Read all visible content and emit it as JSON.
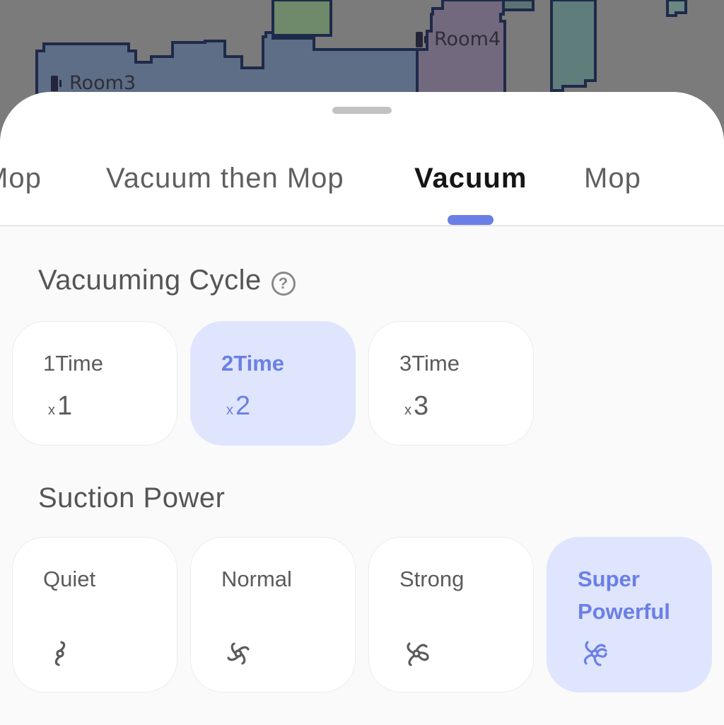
{
  "map": {
    "rooms": [
      {
        "label": "Room3"
      },
      {
        "label": "Room4"
      }
    ]
  },
  "tabs": [
    {
      "label": "Mop"
    },
    {
      "label": "Vacuum then Mop"
    },
    {
      "label": "Vacuum",
      "active": true
    },
    {
      "label": "Mop"
    }
  ],
  "vacuuming_cycle": {
    "title": "Vacuuming Cycle",
    "help_icon": "question-circle-icon",
    "help_glyph": "?",
    "options": [
      {
        "label": "1Time",
        "x": "x",
        "count": "1",
        "selected": false
      },
      {
        "label": "2Time",
        "x": "x",
        "count": "2",
        "selected": true
      },
      {
        "label": "3Time",
        "x": "x",
        "count": "3",
        "selected": false
      }
    ]
  },
  "suction_power": {
    "title": "Suction Power",
    "options": [
      {
        "label": "Quiet",
        "icon": "fan-level-1-icon",
        "selected": false
      },
      {
        "label": "Normal",
        "icon": "fan-level-2-icon",
        "selected": false
      },
      {
        "label": "Strong",
        "icon": "fan-level-3-icon",
        "selected": false
      },
      {
        "label": "Super Powerful",
        "icon": "fan-level-4-icon",
        "selected": true
      }
    ]
  },
  "colors": {
    "accent": "#6a7fe6",
    "selected_bg": "#dfe5fd",
    "map_bg": "#7b7b7b"
  }
}
